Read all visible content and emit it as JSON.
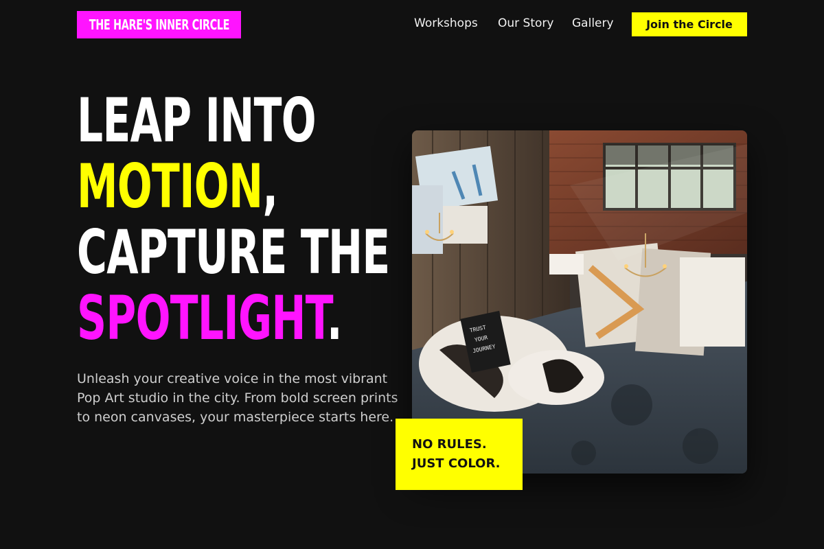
{
  "header": {
    "logo_text": "THE HARE'S INNER CIRCLE",
    "nav": [
      {
        "label": "Workshops"
      },
      {
        "label": "Our Story"
      },
      {
        "label": "Gallery"
      }
    ],
    "cta_label": "Join the Circle"
  },
  "hero": {
    "line1": "LEAP INTO",
    "line2_highlight": "MOTION",
    "line2_rest": ",",
    "line3": "CAPTURE THE",
    "line4_highlight": "SPOTLIGHT",
    "line4_rest": ".",
    "intro": "Unleash your creative voice in the most vibrant Pop Art studio in the city. From bold screen prints to neon canvases, your masterpiece starts here.",
    "image_alt": "art studio interior",
    "callout_line1": "NO RULES.",
    "callout_line2": "JUST COLOR."
  },
  "colors": {
    "background": "#111111",
    "magenta": "#ff14ff",
    "yellow": "#ffff00",
    "text": "#ffffff"
  }
}
